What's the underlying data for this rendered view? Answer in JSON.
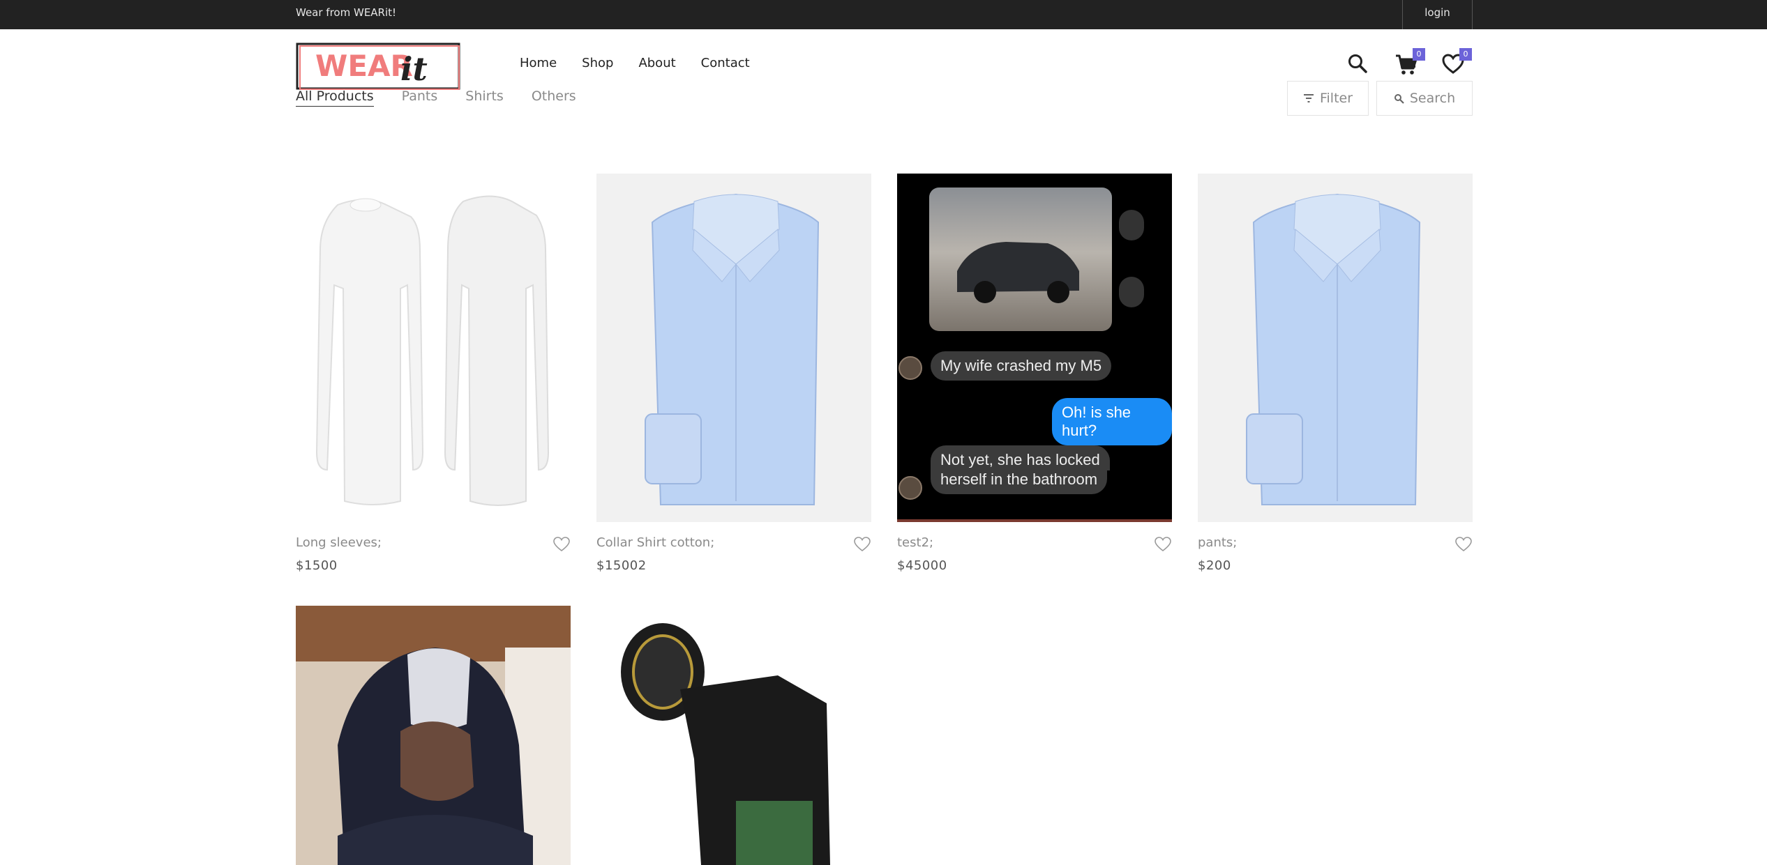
{
  "topbar": {
    "greeting": "Wear from WEARit!",
    "login_label": "login"
  },
  "brand": {
    "logo_text_main": "WEAR",
    "logo_text_script": "it",
    "logo_color": "#f07c7c"
  },
  "nav": {
    "items": [
      "Home",
      "Shop",
      "About",
      "Contact"
    ]
  },
  "categories": {
    "items": [
      "All Products",
      "Pants",
      "Shirts",
      "Others"
    ],
    "active": "All Products"
  },
  "header_icons": {
    "search_icon": "search-icon",
    "cart_icon": "cart-icon",
    "cart_count": "0",
    "wishlist_icon": "heart-icon",
    "wishlist_count": "0",
    "accent": "#6c63d9"
  },
  "toolbar": {
    "filter_label": "Filter",
    "search_label": "Search"
  },
  "products": [
    {
      "name": "Long sleeves;",
      "price": "$1500",
      "image": "white long sleeve shirts"
    },
    {
      "name": "Collar Shirt cotton;",
      "price": "$15002",
      "image": "blue striped collar shirt"
    },
    {
      "name": "test2;",
      "price": "$45000",
      "image": "chat screenshot"
    },
    {
      "name": "pants;",
      "price": "$200",
      "image": "blue striped collar shirt"
    },
    {
      "name": "",
      "price": "",
      "image": "person in hoodie"
    },
    {
      "name": "",
      "price": "",
      "image": "camera"
    }
  ],
  "chat_image": {
    "messages": [
      "My wife crashed my M5",
      "Oh! is she hurt?",
      "Not yet, she has locked",
      "herself in the bathroom"
    ]
  }
}
